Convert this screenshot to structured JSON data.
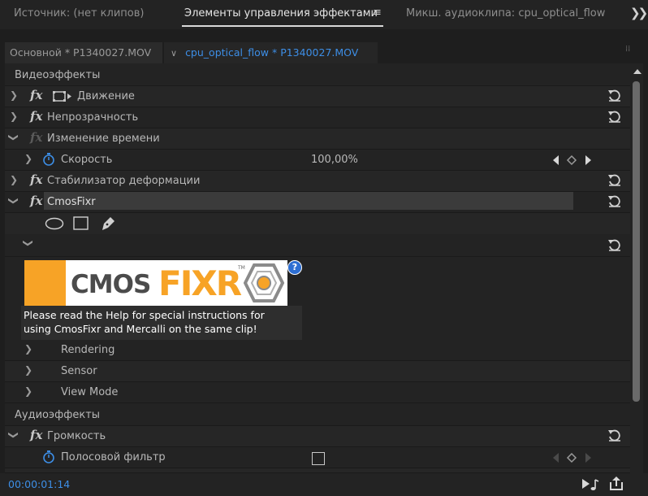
{
  "tabs": {
    "source": "Источник: (нет клипов)",
    "effect_controls": "Элементы управления эффектами",
    "audio_mixer": "Микш. аудиоклипа: cpu_optical_flow"
  },
  "subtabs": {
    "master": "Основной * P1340027.MOV",
    "sequence": "cpu_optical_flow * P1340027.MOV"
  },
  "sections": {
    "video": "Видеоэффекты",
    "audio": "Аудиоэффекты"
  },
  "effects": {
    "motion": "Движение",
    "opacity": "Непрозрачность",
    "time_remap": "Изменение времени",
    "speed_label": "Скорость",
    "speed_value": "100,00%",
    "warp": "Стабилизатор деформации",
    "cmosfixr": "CmosFixr",
    "rendering": "Rendering",
    "sensor": "Sensor",
    "view_mode": "View Mode",
    "volume": "Громкость",
    "bypass": "Полосовой фильтр"
  },
  "logo": {
    "cmos": "CMOS",
    "fixr": "FIXR",
    "tm": "TM"
  },
  "help": {
    "line1": "Please read the Help for special instructions for",
    "line2": "using CmosFixr and Mercalli on the same clip!",
    "q": "?"
  },
  "timecode": "00:00:01:14",
  "colors": {
    "accent": "#3d8ee6",
    "logo_orange": "#f7a326"
  }
}
